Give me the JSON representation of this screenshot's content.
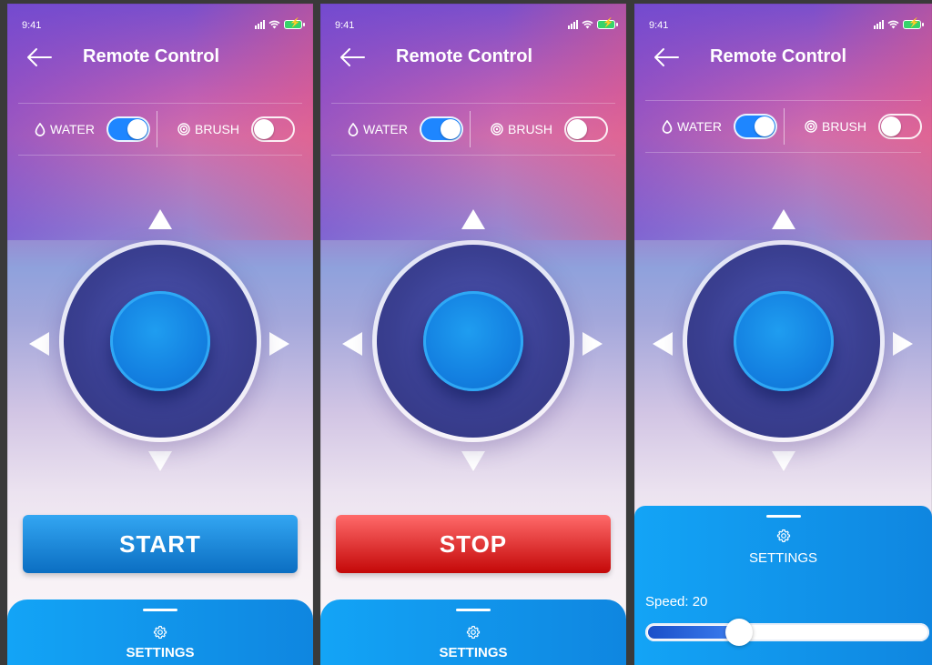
{
  "screens": [
    {
      "status_time": "9:41",
      "title": "Remote Control",
      "water_label": "WATER",
      "brush_label": "BRUSH",
      "water_on": true,
      "brush_on": false,
      "action_label": "START",
      "settings_label": "SETTINGS"
    },
    {
      "status_time": "9:41",
      "title": "Remote Control",
      "water_label": "WATER",
      "brush_label": "BRUSH",
      "water_on": true,
      "brush_on": false,
      "action_label": "STOP",
      "settings_label": "SETTINGS"
    },
    {
      "status_time": "9:41",
      "title": "Remote Control",
      "water_label": "WATER",
      "brush_label": "BRUSH",
      "water_on": true,
      "brush_on": false,
      "settings_label": "SETTINGS",
      "speed_label": "Speed: 20",
      "speed_slider_fraction": 0.33
    }
  ],
  "icons": {
    "back": "arrow-left-icon",
    "water": "water-drop-icon",
    "brush": "brush-icon",
    "settings": "gear-icon"
  },
  "colors": {
    "accent_blue": "#1e86ff",
    "start_button": "#0b6ec2",
    "stop_button": "#c40808",
    "sheet_blue": "#13a4f6",
    "joystick_base": "#3a3f91"
  }
}
